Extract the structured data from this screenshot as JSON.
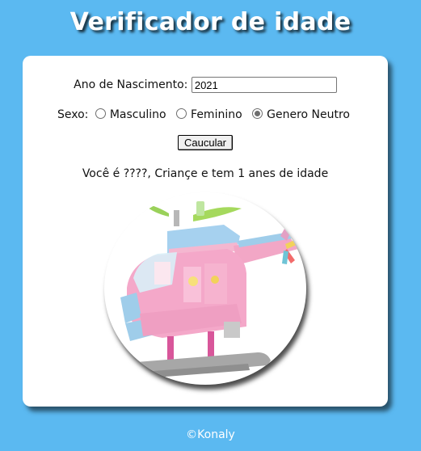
{
  "page": {
    "title": "Verificador de idade",
    "footer": "©Konaly"
  },
  "form": {
    "year_label": "Ano de Nascimento:",
    "year_value": "2021",
    "sex_label": "Sexo:",
    "sex_options": [
      "Masculino",
      "Feminino",
      "Genero Neutro"
    ],
    "sex_selected": "Genero Neutro",
    "calc_button": "Caucular"
  },
  "result": {
    "text": "Você é ????, Criançe e tem 1 anes de idade"
  },
  "image": {
    "subject": "pink toy helicopter"
  },
  "colors": {
    "background": "#5bb9f1",
    "card": "#ffffff",
    "title_text": "#ffffff"
  }
}
